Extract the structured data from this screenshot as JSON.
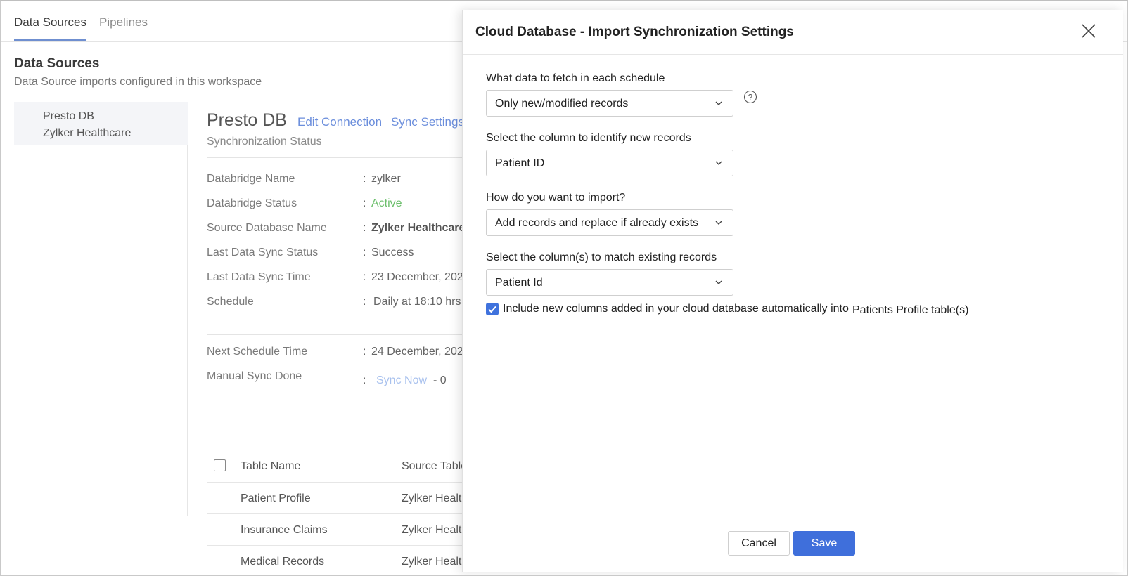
{
  "nav": {
    "tabs": [
      {
        "label": "Data Sources"
      },
      {
        "label": "Pipelines"
      }
    ]
  },
  "page": {
    "title": "Data Sources",
    "subtitle": "Data Source imports configured in this workspace"
  },
  "sidebar": {
    "items": [
      {
        "line1": "Presto DB",
        "line2": "Zylker Healthcare"
      }
    ]
  },
  "datasource": {
    "name": "Presto DB",
    "edit_connection": "Edit Connection",
    "sync_settings": "Sync Settings",
    "section_title": "Synchronization Status",
    "info": [
      {
        "label": "Databridge Name",
        "value": "zylker"
      },
      {
        "label": "Databridge Status",
        "value": "Active"
      },
      {
        "label": "Source Database Name",
        "value": "Zylker Healthcare"
      },
      {
        "label": "Last Data Sync Status",
        "value": "Success"
      },
      {
        "label": "Last Data Sync Time",
        "value": "23 December, 202"
      },
      {
        "label": "Schedule",
        "value": "Daily at 18:10 hrs"
      }
    ],
    "info2": [
      {
        "label": "Next Schedule Time",
        "value": "24 December, 202"
      },
      {
        "label": "Manual Sync Done",
        "link": "Sync Now",
        "value": "- 0"
      }
    ],
    "colon": ":",
    "table": {
      "headers": [
        "Table Name",
        "Source Table"
      ],
      "rows": [
        {
          "name": "Patient Profile",
          "source": "Zylker Healt"
        },
        {
          "name": "Insurance Claims",
          "source": "Zylker Healt"
        },
        {
          "name": "Medical Records",
          "source": "Zylker Healt"
        }
      ]
    }
  },
  "dialog": {
    "title": "Cloud Database - Import Synchronization Settings",
    "fields": [
      {
        "label": "What data to fetch in each schedule",
        "value": "Only new/modified records"
      },
      {
        "label": "Select the column to identify new records",
        "value": "Patient ID"
      },
      {
        "label": "How do you want to import?",
        "value": "Add records and replace if already exists"
      },
      {
        "label": "Select the column(s) to match existing records",
        "value": "Patient Id"
      }
    ],
    "checkbox": {
      "checked": true,
      "label": "Include new columns added in your cloud database automatically into",
      "target": "Patients Profile table(s)"
    },
    "cancel_label": "Cancel",
    "save_label": "Save"
  },
  "colors": {
    "accent": "#3f6fdb",
    "active": "#6cbf6c",
    "link": "#6b8edc"
  }
}
